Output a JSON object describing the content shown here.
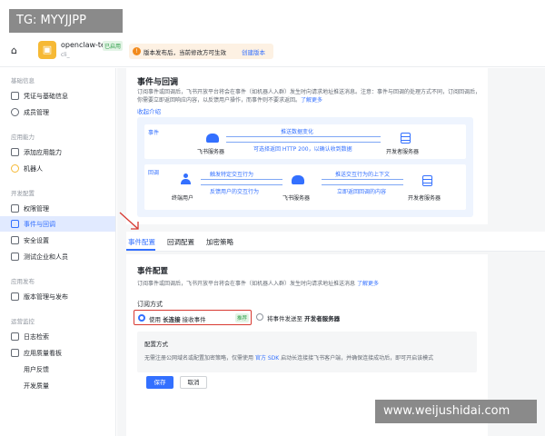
{
  "watermark_top": "TG: MYYJJPP",
  "watermark_bottom": "www.weijushidai.com",
  "header": {
    "app_name": "openclaw-test",
    "app_status": "已启用",
    "app_id": "cli_",
    "notice": "版本发布后，当前修改方可生效",
    "create_version": "创建版本"
  },
  "sidebar": {
    "groups": [
      {
        "label": "基础信息",
        "items": [
          "凭证与基础信息",
          "成员管理"
        ]
      },
      {
        "label": "应用能力",
        "items": [
          "添加应用能力",
          "机器人"
        ]
      },
      {
        "label": "开发配置",
        "items": [
          "权限管理",
          "事件与回调",
          "安全设置",
          "测试企业和人员"
        ]
      },
      {
        "label": "应用发布",
        "items": [
          "版本管理与发布"
        ]
      },
      {
        "label": "运营监控",
        "items": [
          "日志检索",
          "应用质量看板",
          "用户反馈",
          "开发质量"
        ]
      }
    ]
  },
  "page": {
    "title": "事件与回调",
    "description": "订阅事件或回调后，飞书开放平台将会在事件（如机器人入群）发生时向请求地址推送消息。注意：事件与回调的处理方式不同，订阅回调后，你需要立即返回响应内容，以反馈用户操作，而事件则不要求返回。",
    "description_link": "了解更多",
    "collapse": "收起介绍"
  },
  "diagram": {
    "event_tag": "事件",
    "callback_tag": "回调",
    "feishu_server": "飞书服务器",
    "dev_server": "开发者服务器",
    "end_user": "终端用户",
    "push_data_change": "推送数据变化",
    "return_200": "可选择返回 HTTP 200，以确认收到数据",
    "trigger_interaction": "触发特定交互行为",
    "feedback_interaction": "反馈用户的交互行为",
    "push_context": "推送交互行为的上下文",
    "return_response": "立即返回回调的内容"
  },
  "tabs": [
    "事件配置",
    "回调配置",
    "加密策略"
  ],
  "event_config": {
    "title": "事件配置",
    "description": "订阅事件或回调后，飞书开放平台将会在事件（如机器人入群）发生时向请求地址推送消息",
    "description_link": "了解更多",
    "subscribe_title": "订阅方式",
    "option1_prefix": "使用",
    "option1_bold": "长连接",
    "option1_suffix": "接收事件",
    "option1_badge": "推荐",
    "option2_prefix": "将事件发送至",
    "option2_bold": "开发者服务器",
    "info_title": "配置方式",
    "info_text_1": "无需注册公网域名或配置加密策略，仅需使用",
    "info_link": "官方 SDK",
    "info_text_2": "启动长连接接飞书客户端，并确保连接成功后，即可开启该模式",
    "save": "保存",
    "cancel": "取消"
  }
}
